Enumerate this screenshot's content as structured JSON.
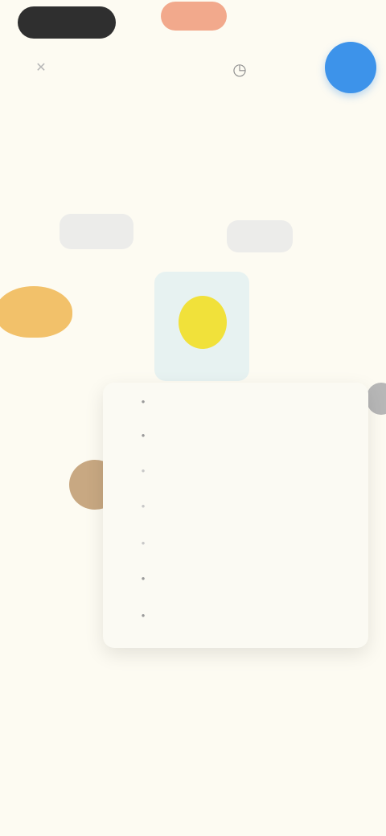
{
  "top_bar": {
    "dark_pill_label": "",
    "orange_pill_label": "",
    "right_text": "",
    "mark_icon": "x-icon",
    "mid_icon": "clock-icon",
    "fab_icon": "profile-circle-icon",
    "colors": {
      "dark_pill": "#2f2f2f",
      "orange_pill": "#f2a98c",
      "fab": "#3d93ea",
      "background": "#fdfbf2"
    }
  },
  "stats": [
    {
      "label": "",
      "value": ""
    },
    {
      "label": "",
      "value": ""
    }
  ],
  "characters": {
    "left": {
      "label": "",
      "sub": ""
    },
    "selected": {
      "label": ""
    },
    "brown": {
      "sub": ""
    }
  },
  "menu": {
    "items": [
      {
        "label": "",
        "icon": "dot-icon"
      },
      {
        "label": "",
        "icon": "dot-icon"
      },
      {
        "label": "",
        "icon": "dot-icon"
      },
      {
        "label": "",
        "icon": "dot-icon"
      },
      {
        "label": "",
        "icon": "dot-icon"
      },
      {
        "label": "",
        "icon": "dot-icon"
      },
      {
        "label": "",
        "icon": "dot-icon"
      }
    ]
  }
}
